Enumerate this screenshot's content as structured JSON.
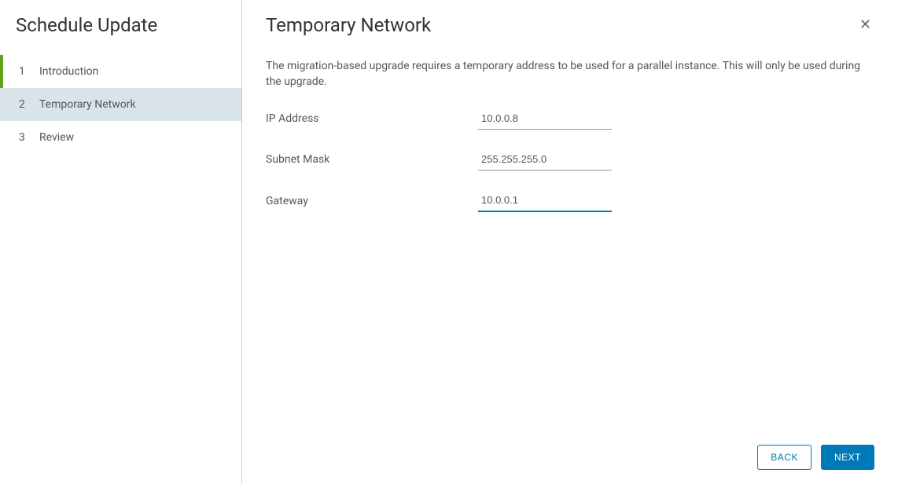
{
  "sidebar": {
    "title": "Schedule Update",
    "steps": [
      {
        "number": "1",
        "label": "Introduction"
      },
      {
        "number": "2",
        "label": "Temporary Network"
      },
      {
        "number": "3",
        "label": "Review"
      }
    ]
  },
  "main": {
    "title": "Temporary Network",
    "description": "The migration-based upgrade requires a temporary address to be used for a parallel instance. This will only be used during the upgrade.",
    "fields": {
      "ip_address": {
        "label": "IP Address",
        "value": "10.0.0.8"
      },
      "subnet_mask": {
        "label": "Subnet Mask",
        "value": "255.255.255.0"
      },
      "gateway": {
        "label": "Gateway",
        "value": "10.0.0.1"
      }
    }
  },
  "footer": {
    "back": "BACK",
    "next": "NEXT"
  },
  "icons": {
    "close": "✕"
  }
}
